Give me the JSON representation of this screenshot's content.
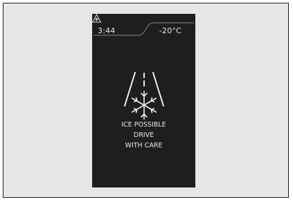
{
  "display": {
    "clock": "3:44",
    "temperature": "-20°C",
    "temperature_icon": "snowflake-warning-icon",
    "warning_icon": "ice-road-icon",
    "message_lines": [
      "ICE POSSIBLE",
      "DRIVE",
      "WITH CARE"
    ]
  },
  "colors": {
    "frame_background": "#e6e6e6",
    "display_background": "#1e1e1e",
    "text": "#e8e8e8"
  }
}
